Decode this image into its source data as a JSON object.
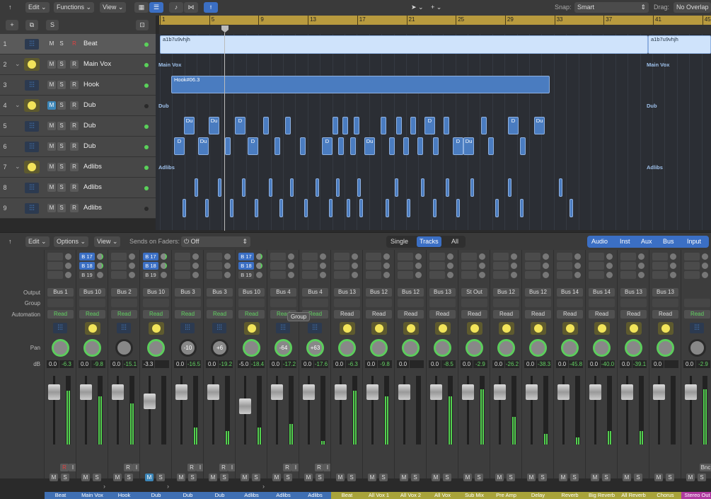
{
  "toolbar": {
    "edit": "Edit",
    "functions": "Functions",
    "view": "View",
    "snap_label": "Snap:",
    "snap_value": "Smart",
    "drag_label": "Drag:",
    "drag_value": "No Overlap"
  },
  "track_header": {
    "s_button": "S"
  },
  "ruler": {
    "bars": [
      "1",
      "5",
      "9",
      "13",
      "17",
      "21",
      "25",
      "29",
      "33",
      "37",
      "41",
      "45"
    ]
  },
  "tracks": [
    {
      "num": "1",
      "name": "Beat",
      "type": "audio",
      "r": "R",
      "r_armed": true,
      "active": true
    },
    {
      "num": "2",
      "name": "Main Vox",
      "type": "stack",
      "r": "R",
      "active": true
    },
    {
      "num": "3",
      "name": "Hook",
      "type": "audio",
      "r": "R",
      "active": true,
      "child": true
    },
    {
      "num": "4",
      "name": "Dub",
      "type": "stack",
      "r": "R",
      "muted": true,
      "active": false
    },
    {
      "num": "5",
      "name": "Dub",
      "type": "audio",
      "r": "R",
      "active": true,
      "child": true
    },
    {
      "num": "6",
      "name": "Dub",
      "type": "audio",
      "r": "R",
      "active": true,
      "child": true
    },
    {
      "num": "7",
      "name": "Adlibs",
      "type": "stack",
      "r": "R",
      "active": true
    },
    {
      "num": "8",
      "name": "Adlibs",
      "type": "audio",
      "r": "R",
      "active": true,
      "child": true
    },
    {
      "num": "9",
      "name": "Adlibs",
      "type": "audio",
      "r": "R",
      "active": false,
      "child": true
    }
  ],
  "ms": {
    "m": "M",
    "s": "S"
  },
  "arrange": {
    "beat_region": "a1b7u9vhjh",
    "beat_region2": "a1b7u9vhjh",
    "hook_region": "Hook#06.3",
    "folder_main": "Main Vox",
    "folder_main2": "Main Vox",
    "folder_dub": "Dub",
    "folder_dub2": "Dub",
    "folder_adlibs": "Adlibs",
    "folder_adlibs2": "Adlibs",
    "dub5_labels": [
      "Du",
      "Du",
      "D",
      "",
      "",
      "",
      "",
      "",
      "",
      "",
      "",
      "D",
      "",
      "",
      "D",
      "Du"
    ],
    "dub6_labels": [
      "D",
      "Du",
      "",
      "D",
      "",
      "",
      "D",
      "",
      "",
      "Du",
      "",
      "",
      "",
      "",
      "D",
      "Du",
      ""
    ]
  },
  "mixer": {
    "edit": "Edit",
    "options": "Options",
    "view": "View",
    "sends_label": "Sends on Faders:",
    "sends_value": "Off",
    "view_tabs": [
      {
        "label": "Single"
      },
      {
        "label": "Tracks",
        "active": true
      },
      {
        "label": "All"
      }
    ],
    "filters": [
      "Audio",
      "Inst",
      "Aux",
      "Bus",
      "Input"
    ],
    "row_labels": {
      "output": "Output",
      "group": "Group",
      "automation": "Automation",
      "pan": "Pan",
      "db": "dB"
    },
    "tooltip": "Group",
    "strips": [
      {
        "name": "Beat",
        "output": "Bus 1",
        "auto": "Read",
        "auto_on": true,
        "icon": "audio",
        "pan": "",
        "pan_on": true,
        "vol": "0.0",
        "peak": "-6.3",
        "sends": [],
        "ri": [
          "R",
          "I"
        ],
        "r_red": true,
        "color": "#3f6fb3",
        "level": 0.78
      },
      {
        "name": "Main Vox",
        "output": "Bus 10",
        "auto": "Read",
        "auto_on": true,
        "icon": "inst",
        "pan": "",
        "pan_on": true,
        "vol": "0.0",
        "peak": "-9.8",
        "sends": [
          "B 17",
          "B 18",
          "B 19"
        ],
        "ri": [],
        "arrow": true,
        "color": "#3f6fb3",
        "level": 0.7
      },
      {
        "name": "Hook",
        "output": "Bus 2",
        "auto": "Read",
        "auto_on": true,
        "icon": "audio",
        "pan": "",
        "pan_on": false,
        "vol": "0.0",
        "peak": "-15.1",
        "sends": [],
        "ri": [
          "R",
          "I"
        ],
        "color": "#3f6fb3",
        "level": 0.6
      },
      {
        "name": "Dub",
        "output": "Bus 10",
        "auto": "Read",
        "auto_on": true,
        "icon": "inst",
        "pan": "",
        "pan_on": true,
        "vol": "-3.3",
        "peak": "",
        "sends": [
          "B 17",
          "B 18",
          "B 19"
        ],
        "ri": [],
        "arrow": true,
        "muted": true,
        "color": "#3f6fb3",
        "level": 0
      },
      {
        "name": "Dub",
        "output": "Bus 3",
        "auto": "Read",
        "auto_on": true,
        "icon": "audio",
        "pan": "-10",
        "pan_on": false,
        "vol": "0.0",
        "peak": "-16.5",
        "sends": [],
        "ri": [
          "R",
          "I"
        ],
        "color": "#3f6fb3",
        "level": 0.25
      },
      {
        "name": "Dub",
        "output": "Bus 3",
        "auto": "Read",
        "auto_on": true,
        "icon": "audio",
        "pan": "+6",
        "pan_on": false,
        "vol": "0.0",
        "peak": "-19.2",
        "sends": [],
        "ri": [
          "R",
          "I"
        ],
        "color": "#3f6fb3",
        "level": 0.2
      },
      {
        "name": "Adlibs",
        "output": "Bus 10",
        "auto": "Read",
        "auto_on": true,
        "icon": "inst",
        "pan": "",
        "pan_on": true,
        "vol": "-5.0",
        "peak": "-18.4",
        "sends": [
          "B 17",
          "B 18",
          "B 19"
        ],
        "ri": [],
        "arrow": true,
        "color": "#3f6fb3",
        "level": 0.25
      },
      {
        "name": "Adlibs",
        "output": "Bus 4",
        "auto": "Read",
        "auto_on": true,
        "icon": "audio",
        "pan": "-64",
        "pan_on": true,
        "vol": "0.0",
        "peak": "-17.2",
        "sends": [],
        "ri": [
          "R",
          "I"
        ],
        "color": "#3f6fb3",
        "level": 0.3
      },
      {
        "name": "Adlibs",
        "output": "Bus 4",
        "auto": "Read",
        "auto_on": true,
        "icon": "audio",
        "pan": "+63",
        "pan_on": true,
        "vol": "0.0",
        "peak": "-17.6",
        "sends": [],
        "ri": [
          "R",
          "I"
        ],
        "color": "#3f6fb3",
        "level": 0.05
      },
      {
        "name": "Beat",
        "output": "Bus 13",
        "auto": "Read",
        "auto_on": false,
        "icon": "inst",
        "pan": "",
        "pan_on": true,
        "vol": "0.0",
        "peak": "-6.3",
        "sends": [],
        "ri": [],
        "color": "#a8a33a",
        "level": 0.78
      },
      {
        "name": "All Vox 1",
        "output": "Bus 12",
        "auto": "Read",
        "auto_on": false,
        "icon": "inst",
        "pan": "",
        "pan_on": true,
        "vol": "0.0",
        "peak": "-9.8",
        "sends": [],
        "ri": [],
        "color": "#a8a33a",
        "level": 0.7
      },
      {
        "name": "All Vox 2",
        "output": "Bus 12",
        "auto": "Read",
        "auto_on": false,
        "icon": "inst",
        "pan": "",
        "pan_on": true,
        "vol": "0.0",
        "peak": "",
        "sends": [],
        "ri": [],
        "color": "#a8a33a",
        "level": 0
      },
      {
        "name": "All Vox",
        "output": "Bus 13",
        "auto": "Read",
        "auto_on": false,
        "icon": "inst",
        "pan": "",
        "pan_on": true,
        "vol": "0.0",
        "peak": "-8.5",
        "sends": [],
        "ri": [],
        "color": "#a8a33a",
        "level": 0.7
      },
      {
        "name": "Sub Mix",
        "output": "St Out",
        "auto": "Read",
        "auto_on": false,
        "icon": "inst",
        "pan": "",
        "pan_on": true,
        "vol": "0.0",
        "peak": "-2.9",
        "sends": [],
        "ri": [],
        "color": "#a8a33a",
        "level": 0.8
      },
      {
        "name": "Pre Amp",
        "output": "Bus 12",
        "auto": "Read",
        "auto_on": false,
        "icon": "inst",
        "pan": "",
        "pan_on": true,
        "vol": "0.0",
        "peak": "-26.2",
        "sends": [],
        "ri": [],
        "color": "#a8a33a",
        "level": 0.4
      },
      {
        "name": "Delay",
        "output": "Bus 12",
        "auto": "Read",
        "auto_on": false,
        "icon": "inst",
        "pan": "",
        "pan_on": true,
        "vol": "0.0",
        "peak": "-38.3",
        "sends": [],
        "ri": [],
        "color": "#a8a33a",
        "level": 0.15
      },
      {
        "name": "Reverb",
        "output": "Bus 14",
        "auto": "Read",
        "auto_on": false,
        "icon": "inst",
        "pan": "",
        "pan_on": true,
        "vol": "0.0",
        "peak": "-45.8",
        "sends": [],
        "ri": [],
        "color": "#a8a33a",
        "level": 0.1
      },
      {
        "name": "Big Reverb",
        "output": "Bus 14",
        "auto": "Read",
        "auto_on": false,
        "icon": "inst",
        "pan": "",
        "pan_on": true,
        "vol": "0.0",
        "peak": "-40.0",
        "sends": [],
        "ri": [],
        "color": "#a8a33a",
        "level": 0.2
      },
      {
        "name": "All Reverb",
        "output": "Bus 13",
        "auto": "Read",
        "auto_on": false,
        "icon": "inst",
        "pan": "",
        "pan_on": true,
        "vol": "0.0",
        "peak": "-39.1",
        "sends": [],
        "ri": [],
        "color": "#a8a33a",
        "level": 0.2
      },
      {
        "name": "Chorus",
        "output": "Bus 13",
        "auto": "Read",
        "auto_on": false,
        "icon": "inst",
        "pan": "",
        "pan_on": true,
        "vol": "0.0",
        "peak": "",
        "sends": [],
        "ri": [],
        "color": "#a8a33a",
        "level": 0
      },
      {
        "name": "Stereo Out",
        "output": "",
        "auto": "Read",
        "auto_on": true,
        "icon": "audio",
        "pan": "",
        "pan_on": false,
        "vol": "0.0",
        "peak": "-2.9",
        "sends": [],
        "ri": [
          "Bnc"
        ],
        "color": "#b03aa0",
        "level": 0.8
      }
    ]
  }
}
